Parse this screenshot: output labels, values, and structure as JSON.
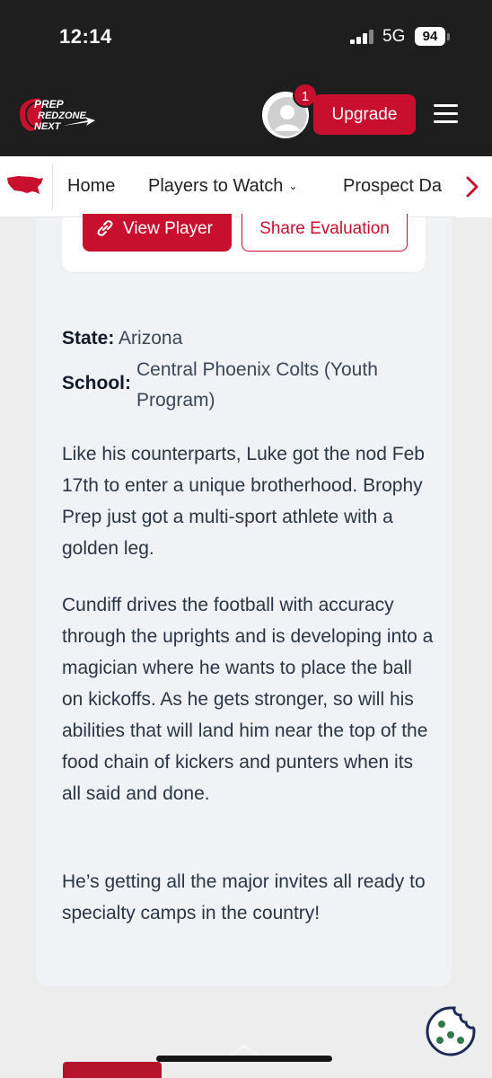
{
  "status_bar": {
    "time": "12:14",
    "network": "5G",
    "battery": "94"
  },
  "header": {
    "logo_icon": "prep-redzone-next-logo",
    "logo_text": "PREP REDZONE NEXT",
    "notification_count": "1",
    "upgrade_label": "Upgrade",
    "brand_color": "#c8102e"
  },
  "nav": {
    "items": [
      {
        "label": "Home"
      },
      {
        "label": "Players to Watch",
        "has_dropdown": true
      },
      {
        "label": "Prospect Da"
      }
    ]
  },
  "player_actions": {
    "view_player_label": "View Player",
    "share_evaluation_label": "Share Evaluation"
  },
  "player_info": {
    "state_label": "State:",
    "state_value": "Arizona",
    "school_label": "School:",
    "school_value": "Central Phoenix Colts (Youth Program)"
  },
  "article": {
    "paragraphs": [
      "Like his counterparts, Luke got the nod Feb 17th to enter a unique brotherhood. Brophy Prep just got a multi-sport athlete with a golden leg.",
      "Cundiff drives the football with accuracy through the uprights and is developing into a magician where he wants to place the ball on kickoffs. As he gets stronger, so will his abilities that will land him near the top of the food chain of kickers and punters when its all said and done.",
      "He’s getting all the major invites all ready to specialty camps in the country!"
    ]
  }
}
